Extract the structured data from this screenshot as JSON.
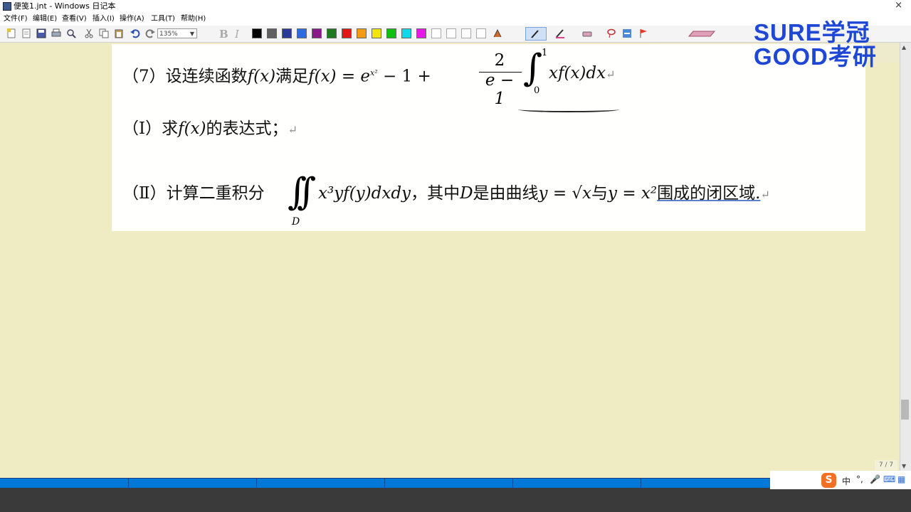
{
  "window": {
    "title": "便笺1.jnt - Windows 日记本",
    "close_glyph": "×"
  },
  "menu": [
    "文件(F)",
    "编辑(E)",
    "查看(V)",
    "插入(I)",
    "操作(A)",
    "工具(T)",
    "帮助(H)"
  ],
  "toolbar": {
    "zoom_value": "135%",
    "bold": "B",
    "italic": "I",
    "colors": [
      "#000000",
      "#606060",
      "#2a3a9a",
      "#2f6be0",
      "#8a1a8a",
      "#1f7a1f",
      "#e01818",
      "#f49a10",
      "#f5e40a",
      "#10c010",
      "#10d8e8",
      "#e818e8",
      "#ffffff",
      "#ffffff",
      "#ffffff",
      "#ffffff"
    ]
  },
  "logo": {
    "line1": "SURE学冠",
    "line2": "GOOD考研"
  },
  "note": {
    "q7_label": "（7）设连续函数",
    "q7_fx1": "f(x)",
    "q7_mid": "满足",
    "q7_fx2": "f(x)",
    "q7_eq": " = e",
    "q7_sup": "x²",
    "q7_rest": " − 1 + ",
    "frac_num": "2",
    "frac_den": "e − 1",
    "int_upper": "1",
    "int_lower": "0",
    "integrand": "xf(x)dx",
    "part1_label": "（Ⅰ）求",
    "part1_fx": "f(x)",
    "part1_rest": "的表达式；",
    "part2_label": "（Ⅱ）计算二重积分",
    "part2_integrand": "x³yf(y)dxdy",
    "part2_mid": "，其中",
    "part2_D": "D",
    "part2_text": "是由曲线",
    "part2_eq1": "y = √x",
    "part2_and": "与",
    "part2_eq2": "y = x²",
    "part2_end": "围成的闭区域.",
    "dint_sub": "D",
    "return_mark": "↵"
  },
  "page_info": "7 / 7",
  "ime": {
    "logo": "S",
    "mode": "中",
    "punc": "°,",
    "mic": "🎤",
    "keyboard": "⌨",
    "grid": "▦"
  }
}
